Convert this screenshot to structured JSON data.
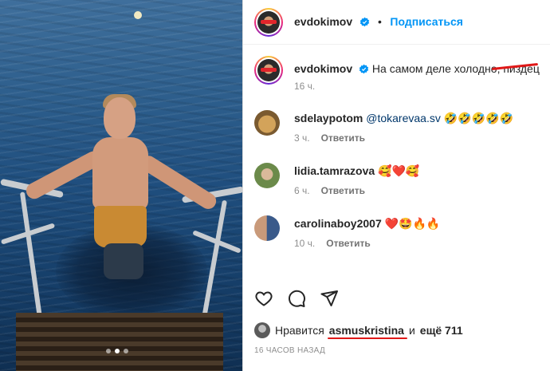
{
  "post": {
    "author": "evdokimov",
    "follow_label": "Подписаться",
    "separator": "•"
  },
  "caption": {
    "author": "evdokimov",
    "text": "На самом деле холодно, пиздец",
    "time": "16 ч."
  },
  "comments": [
    {
      "user": "sdelaypotom",
      "mention": "@tokarevaa.sv",
      "emojis": "🤣🤣🤣🤣🤣",
      "time": "3 ч.",
      "reply": "Ответить"
    },
    {
      "user": "lidia.tamrazova",
      "mention": "",
      "emojis": "🥰❤️🥰",
      "time": "6 ч.",
      "reply": "Ответить"
    },
    {
      "user": "carolinaboy2007",
      "mention": "",
      "emojis": "❤️🤩🔥🔥",
      "time": "10 ч.",
      "reply": "Ответить"
    }
  ],
  "actions": {
    "like": "heart-icon",
    "comment": "comment-icon",
    "share": "share-icon"
  },
  "likes": {
    "prefix": "Нравится",
    "user": "asmuskristina",
    "joiner": "и",
    "rest": "ещё 711"
  },
  "posted": "16 ЧАСОВ НАЗАД",
  "carousel": {
    "count": 3,
    "active": 2
  },
  "colors": {
    "accent": "#0095f6",
    "muted": "#8e8e8e",
    "mention": "#00376b",
    "annotation_red": "#e01818"
  }
}
